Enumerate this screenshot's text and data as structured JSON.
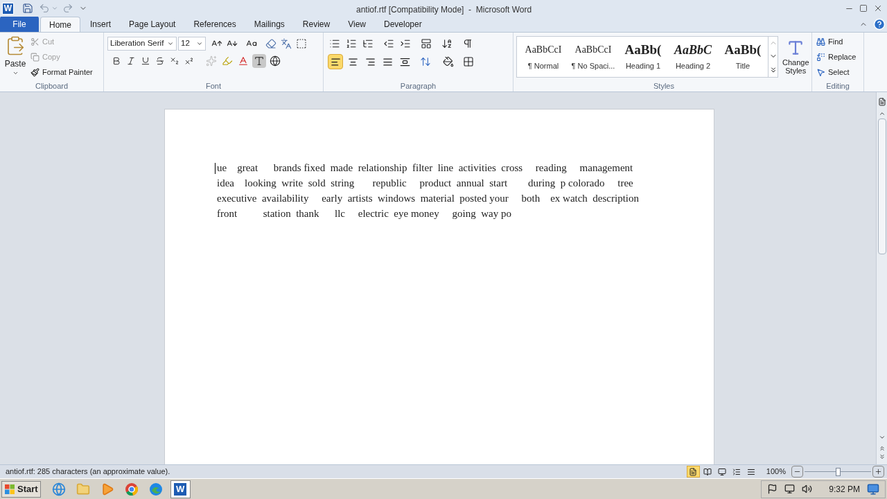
{
  "title_bar": {
    "logo": "W",
    "title": "antiof.rtf [Compatibility Mode]  -  Microsoft Word"
  },
  "tabs": [
    {
      "label": "File",
      "kind": "file",
      "selected": false
    },
    {
      "label": "Home",
      "kind": "tab",
      "selected": true
    },
    {
      "label": "Insert",
      "kind": "tab",
      "selected": false
    },
    {
      "label": "Page Layout",
      "kind": "tab",
      "selected": false
    },
    {
      "label": "References",
      "kind": "tab",
      "selected": false
    },
    {
      "label": "Mailings",
      "kind": "tab",
      "selected": false
    },
    {
      "label": "Review",
      "kind": "tab",
      "selected": false
    },
    {
      "label": "View",
      "kind": "tab",
      "selected": false
    },
    {
      "label": "Developer",
      "kind": "tab",
      "selected": false
    }
  ],
  "clipboard": {
    "group": "Clipboard",
    "paste": "Paste",
    "items": [
      {
        "label": "Cut",
        "disabled": true
      },
      {
        "label": "Copy",
        "disabled": true
      },
      {
        "label": "Format Painter",
        "disabled": false
      }
    ]
  },
  "font": {
    "group": "Font",
    "name": "Liberation Serif",
    "size": "12"
  },
  "paragraph": {
    "group": "Paragraph",
    "alignments": [
      {
        "selected": true
      },
      {
        "selected": false
      },
      {
        "selected": false
      },
      {
        "selected": false
      },
      {
        "selected": false
      }
    ]
  },
  "styles": {
    "group": "Styles",
    "items": [
      {
        "sample": "AaBbCcI",
        "label": "¶ Normal",
        "kind": "plain"
      },
      {
        "sample": "AaBbCcI",
        "label": "¶ No Spaci...",
        "kind": "plain"
      },
      {
        "sample": "AaBb(",
        "label": "Heading 1",
        "kind": "bold"
      },
      {
        "sample": "AaBbC",
        "label": "Heading 2",
        "kind": "bolditalic"
      },
      {
        "sample": "AaBb(",
        "label": "Title",
        "kind": "bold"
      }
    ],
    "change_styles": [
      "Change",
      "Styles"
    ]
  },
  "editing": {
    "group": "Editing",
    "items": [
      {
        "label": "Find",
        "kind": "find"
      },
      {
        "label": "Replace",
        "kind": "replace"
      },
      {
        "label": "Select",
        "kind": "select"
      }
    ]
  },
  "document": {
    "lines": [
      "ue    great      brands fixed  made  relationship  filter  line  activities  cross     reading     management",
      "idea    looking  write  sold  string       republic     product  annual  start        during  p colorado     tree",
      "executive  availability     early  artists  windows  material  posted your     both    ex watch  description",
      "front          station  thank      llc     electric  eye money     going  way po"
    ]
  },
  "status_bar": {
    "text": "antiof.rtf: 285 characters (an approximate value).",
    "views": [
      {
        "selected": true
      },
      {
        "selected": false
      },
      {
        "selected": false
      },
      {
        "selected": false
      },
      {
        "selected": false
      }
    ],
    "zoom": "100%",
    "level": 0.5
  },
  "taskbar": {
    "start": "Start",
    "apps": [
      {
        "kind": "ie",
        "selected": false
      },
      {
        "kind": "folder",
        "selected": false
      },
      {
        "kind": "media",
        "selected": false
      },
      {
        "kind": "chrome",
        "selected": false
      },
      {
        "kind": "edge",
        "selected": false
      },
      {
        "kind": "word",
        "selected": true,
        "label": "W"
      }
    ],
    "time": "9:32 PM"
  }
}
